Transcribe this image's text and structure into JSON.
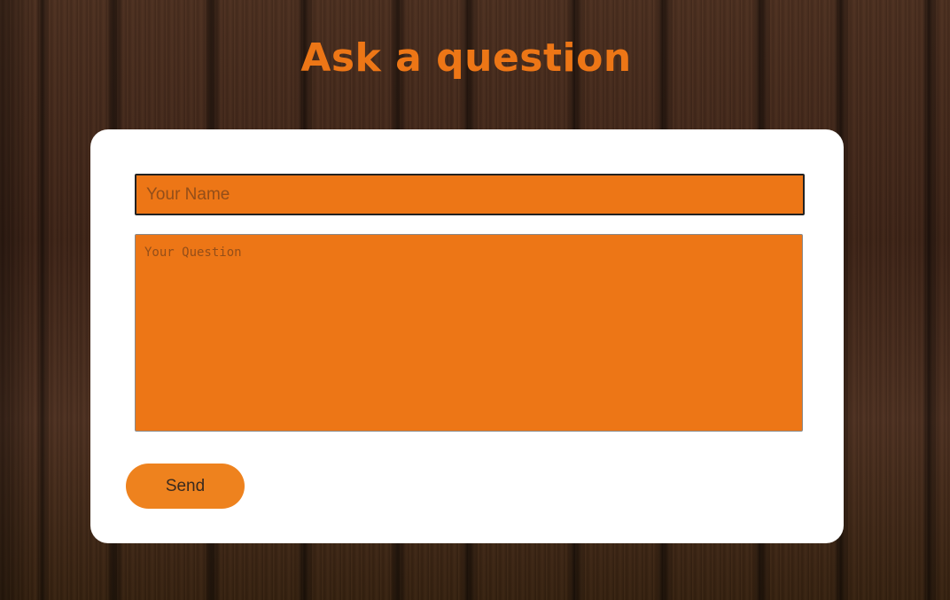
{
  "page": {
    "title": "Ask a question"
  },
  "form": {
    "name_placeholder": "Your Name",
    "name_value": "",
    "question_placeholder": "Your Question",
    "question_value": "",
    "send_label": "Send"
  },
  "colors": {
    "accent": "#ed7616",
    "card_background": "#ffffff",
    "button": "#ee821e"
  }
}
